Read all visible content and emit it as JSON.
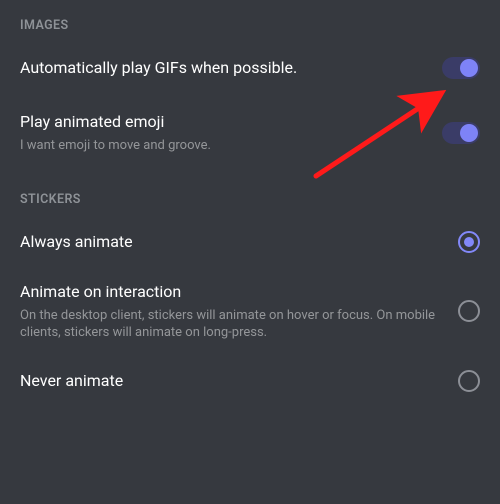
{
  "colors": {
    "accent": "#7e83f7",
    "bg": "#36393f",
    "textMuted": "#8e9297"
  },
  "sections": {
    "images": {
      "header": "IMAGES",
      "gif": {
        "title": "Automatically play GIFs when possible.",
        "enabled": true
      },
      "emoji": {
        "title": "Play animated emoji",
        "sub": "I want emoji to move and groove.",
        "enabled": true
      }
    },
    "stickers": {
      "header": "STICKERS",
      "options": {
        "always": {
          "title": "Always animate",
          "selected": true
        },
        "interact": {
          "title": "Animate on interaction",
          "sub": "On the desktop client, stickers will animate on hover or focus. On mobile clients, stickers will animate on long-press.",
          "selected": false
        },
        "never": {
          "title": "Never animate",
          "selected": false
        }
      }
    }
  }
}
